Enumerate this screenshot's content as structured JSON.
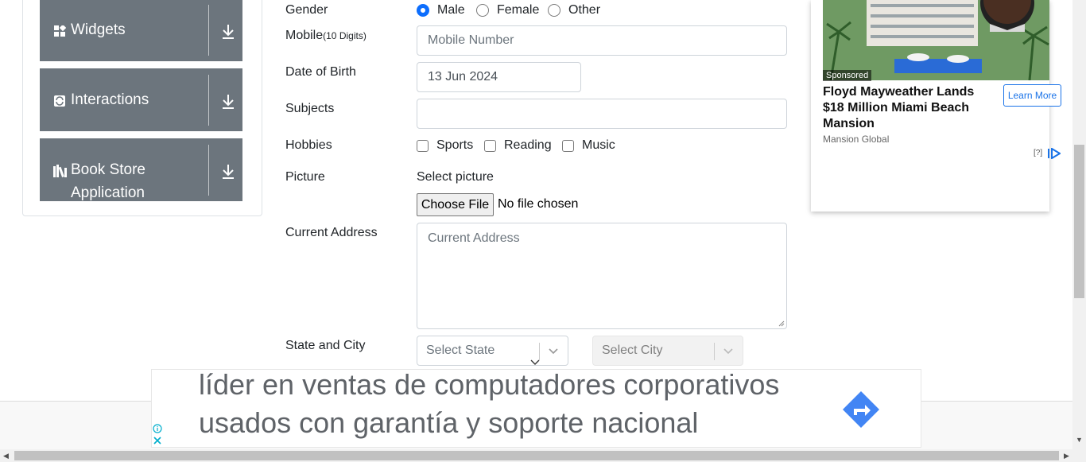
{
  "sidebar": {
    "groups": [
      {
        "label": "Widgets",
        "icon": "widgets-icon"
      },
      {
        "label": "Interactions",
        "icon": "interactions-icon"
      },
      {
        "label": "Book Store",
        "label2": "Application",
        "icon": "book-store-icon"
      }
    ]
  },
  "form": {
    "gender_label": "Gender",
    "gender_options": [
      "Male",
      "Female",
      "Other"
    ],
    "gender_selected": "Male",
    "mobile_label": "Mobile",
    "mobile_hint": "(10 Digits)",
    "mobile_placeholder": "Mobile Number",
    "dob_label": "Date of Birth",
    "dob_value": "13 Jun 2024",
    "subjects_label": "Subjects",
    "subjects_value": "",
    "hobbies_label": "Hobbies",
    "hobbies": [
      "Sports",
      "Reading",
      "Music"
    ],
    "picture_label": "Picture",
    "picture_prompt": "Select picture",
    "choose_file_label": "Choose File",
    "no_file_text": "No file chosen",
    "address_label": "Current Address",
    "address_placeholder": "Current Address",
    "state_city_label": "State and City",
    "state_placeholder": "Select State",
    "city_placeholder": "Select City"
  },
  "ad_card": {
    "sponsored": "Sponsored",
    "title": "Floyd Mayweather Lands $18 Million Miami Beach Mansion",
    "source": "Mansion Global",
    "cta": "Learn More",
    "help": "[?]"
  },
  "banner": {
    "line1": "líder en ventas de computadores corporativos",
    "line2": "usados con garantía y soporte nacional"
  },
  "colors": {
    "sidebar_bg": "#6c757d",
    "accent": "#0d6efd",
    "banner_cta": "#4285f4"
  }
}
